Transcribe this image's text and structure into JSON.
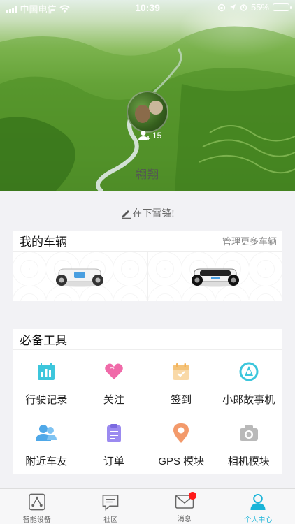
{
  "status_bar": {
    "carrier": "中国电信",
    "time": "10:39",
    "battery": "55%",
    "battery_level": 0.55
  },
  "profile": {
    "follow_count": "15",
    "username": "翱翔",
    "signature": "在下雷锋!"
  },
  "vehicles": {
    "title": "我的车辆",
    "manage_link": "管理更多车辆",
    "items": [
      {
        "icon": "hoverboard-white-icon"
      },
      {
        "icon": "hoverboard-black-icon"
      }
    ]
  },
  "tools": {
    "title": "必备工具",
    "items": [
      {
        "label": "行驶记录",
        "icon": "driving-record-icon",
        "color": "#3cc6dc"
      },
      {
        "label": "关注",
        "icon": "heart-icon",
        "color": "#f06aa9"
      },
      {
        "label": "签到",
        "icon": "calendar-checkin-icon",
        "color": "#f4c37a"
      },
      {
        "label": "小郎故事机",
        "icon": "story-machine-icon",
        "color": "#3cc6dc"
      },
      {
        "label": "附近车友",
        "icon": "nearby-friends-icon",
        "color": "#4fa8e8"
      },
      {
        "label": "订单",
        "icon": "order-icon",
        "color": "#9b8af0"
      },
      {
        "label": "GPS 模块",
        "icon": "location-pin-icon",
        "color": "#f39a6b"
      },
      {
        "label": "相机模块",
        "icon": "camera-icon",
        "color": "#b9b9b9"
      }
    ]
  },
  "tabbar": {
    "active_color": "#19b4d8",
    "items": [
      {
        "label": "智能设备",
        "icon": "smart-device-icon"
      },
      {
        "label": "社区",
        "icon": "community-icon"
      },
      {
        "label": "消息",
        "icon": "message-icon"
      },
      {
        "label": "个人中心",
        "icon": "person-icon"
      }
    ]
  }
}
